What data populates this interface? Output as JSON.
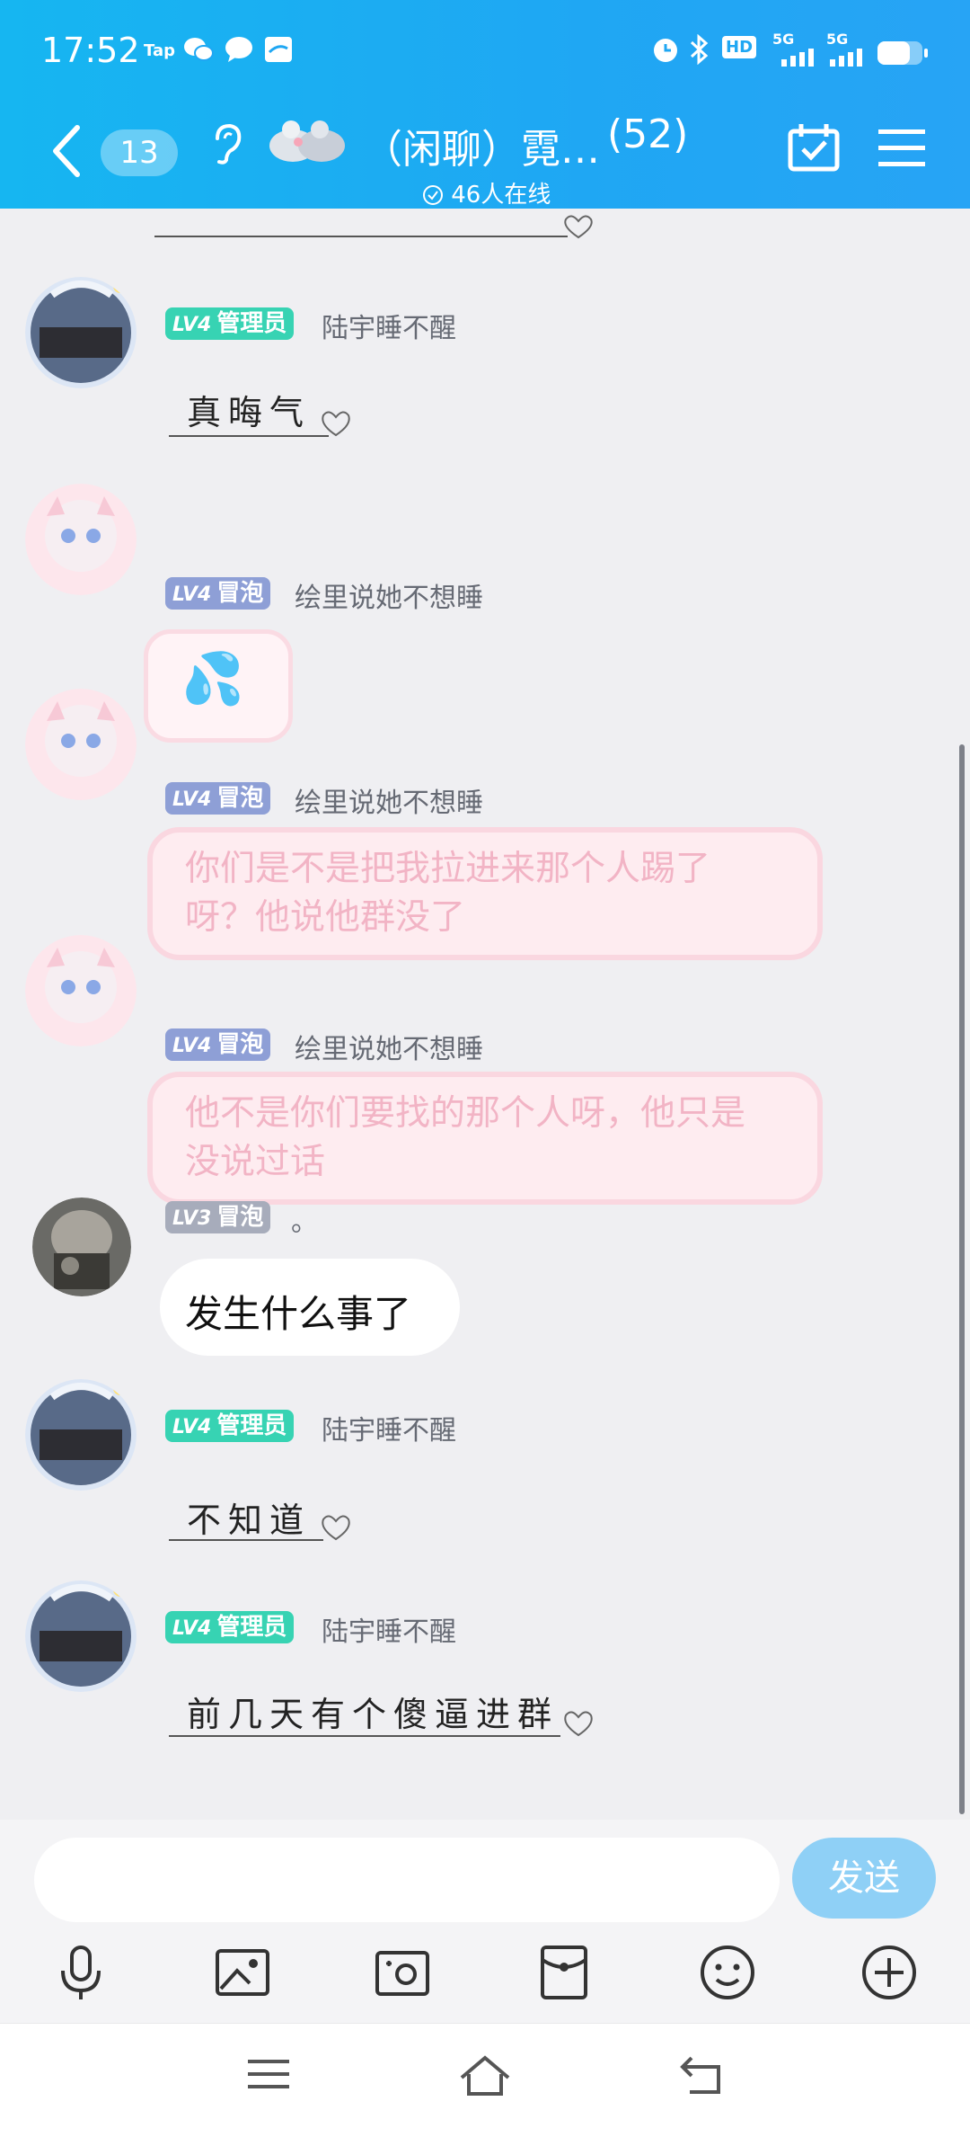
{
  "status_bar": {
    "time": "17:52",
    "left_icons": [
      "taptap-icon",
      "wechat-icon",
      "message-icon",
      "browser-icon"
    ],
    "right_icons": [
      "alarm-icon",
      "bluetooth-icon",
      "hd-icon",
      "signal-5g-icon",
      "signal-5g-icon",
      "battery-icon"
    ],
    "taptap_label": "Tap",
    "hd_label": "HD",
    "net1": "5G",
    "net2": "5G"
  },
  "header": {
    "unread": "13",
    "title": "（闲聊）霓…",
    "member_count": "(52)",
    "online": "46人在线"
  },
  "messages": [
    {
      "badge_level": "LV4",
      "badge_role": "管理员",
      "nickname": "陆宇睡不醒",
      "text": "真晦气",
      "style": "handwritten"
    },
    {
      "badge_level": "LV4",
      "badge_role": "冒泡",
      "nickname": "绘里说她不想睡",
      "text": "💦",
      "style": "sticker"
    },
    {
      "badge_level": "LV4",
      "badge_role": "冒泡",
      "nickname": "绘里说她不想睡",
      "text": "你们是不是把我拉进来那个人踢了呀？他说他群没了",
      "style": "pink"
    },
    {
      "badge_level": "LV4",
      "badge_role": "冒泡",
      "nickname": "绘里说她不想睡",
      "text": "他不是你们要找的那个人呀，他只是没说过话",
      "style": "pink"
    },
    {
      "badge_level": "LV3",
      "badge_role": "冒泡",
      "nickname": "。",
      "text": "发生什么事了",
      "style": "plain"
    },
    {
      "badge_level": "LV4",
      "badge_role": "管理员",
      "nickname": "陆宇睡不醒",
      "text": "不知道",
      "style": "handwritten"
    },
    {
      "badge_level": "LV4",
      "badge_role": "管理员",
      "nickname": "陆宇睡不醒",
      "text": "前几天有个傻逼进群",
      "style": "handwritten"
    }
  ],
  "input": {
    "placeholder": "",
    "send_label": "发送"
  },
  "toolbar": [
    "microphone-icon",
    "image-icon",
    "camera-icon",
    "red-packet-icon",
    "emoji-icon",
    "plus-icon"
  ],
  "colors": {
    "header": "#1fa7f3",
    "admin_badge": "#37d3b3",
    "bubble_badge": "#8e9fd6",
    "send": "#8fd0f6"
  }
}
